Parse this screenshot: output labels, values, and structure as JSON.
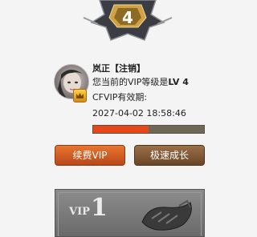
{
  "emblem": {
    "level_number": "4"
  },
  "profile": {
    "name": "岚正",
    "logout_label": "【注销】",
    "vip_level_prefix": "您当前的VIP等级是",
    "vip_level_value": "LV 4",
    "expiry_label": "CFVIP有效期:",
    "expiry_date": "2027-04-02 18:58:46",
    "progress_fraction": 0.5
  },
  "buttons": {
    "renew_label": "续费VIP",
    "growth_label": "极速成长"
  },
  "vip_card": {
    "label": "VIP",
    "number": "1"
  },
  "colors": {
    "progress_fill": "#e8471c",
    "renew_button": "#d0602a",
    "growth_button": "#85592f"
  }
}
